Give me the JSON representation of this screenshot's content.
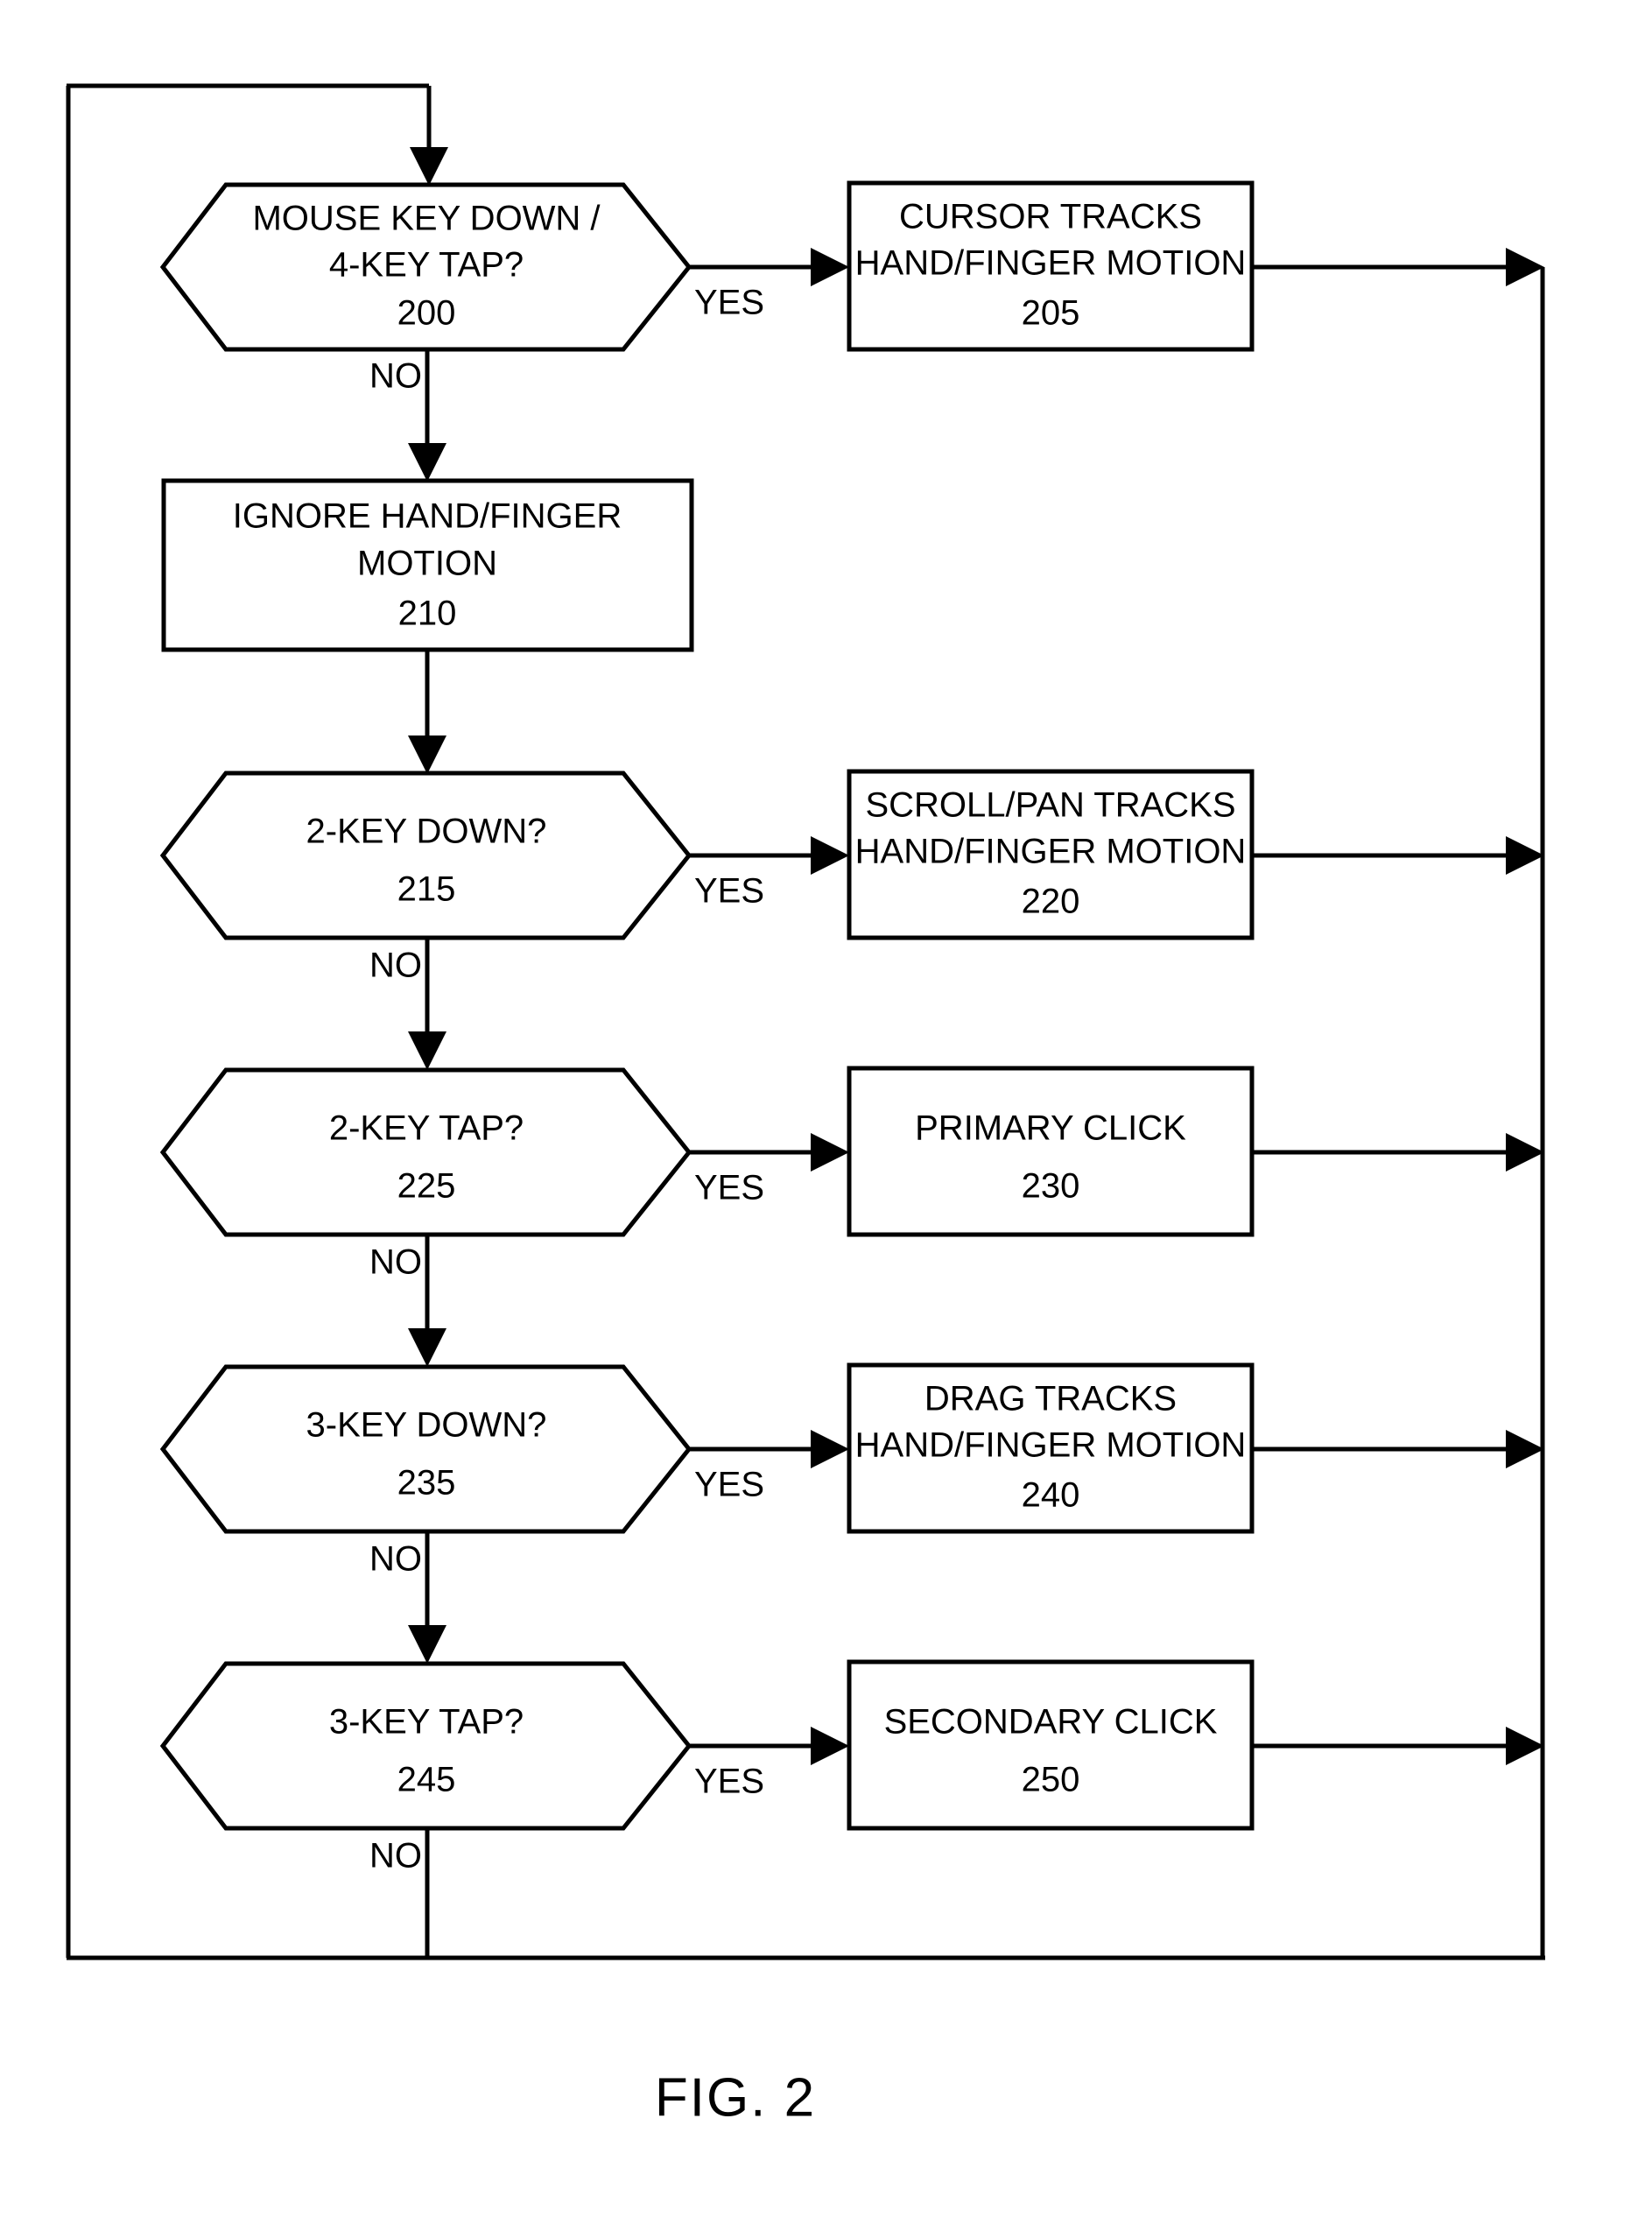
{
  "figure": {
    "caption": "FIG. 2",
    "type": "flowchart"
  },
  "edge_labels": {
    "yes": "YES",
    "no": "NO"
  },
  "nodes": [
    {
      "id": "200",
      "shape": "hexagon",
      "lines": [
        "MOUSE KEY DOWN /",
        "4-KEY TAP?"
      ],
      "ref": "200"
    },
    {
      "id": "205",
      "shape": "rectangle",
      "lines": [
        "CURSOR TRACKS",
        "HAND/FINGER MOTION"
      ],
      "ref": "205"
    },
    {
      "id": "210",
      "shape": "rectangle",
      "lines": [
        "IGNORE HAND/FINGER",
        "MOTION"
      ],
      "ref": "210"
    },
    {
      "id": "215",
      "shape": "hexagon",
      "lines": [
        "2-KEY DOWN?"
      ],
      "ref": "215"
    },
    {
      "id": "220",
      "shape": "rectangle",
      "lines": [
        "SCROLL/PAN TRACKS",
        "HAND/FINGER MOTION"
      ],
      "ref": "220"
    },
    {
      "id": "225",
      "shape": "hexagon",
      "lines": [
        "2-KEY TAP?"
      ],
      "ref": "225"
    },
    {
      "id": "230",
      "shape": "rectangle",
      "lines": [
        "PRIMARY CLICK"
      ],
      "ref": "230"
    },
    {
      "id": "235",
      "shape": "hexagon",
      "lines": [
        "3-KEY DOWN?"
      ],
      "ref": "235"
    },
    {
      "id": "240",
      "shape": "rectangle",
      "lines": [
        "DRAG TRACKS",
        "HAND/FINGER MOTION"
      ],
      "ref": "240"
    },
    {
      "id": "245",
      "shape": "hexagon",
      "lines": [
        "3-KEY TAP?"
      ],
      "ref": "245"
    },
    {
      "id": "250",
      "shape": "rectangle",
      "lines": [
        "SECONDARY CLICK"
      ],
      "ref": "250"
    }
  ],
  "text": {
    "n200_l1": "MOUSE KEY DOWN /",
    "n200_l2": "4-KEY TAP?",
    "n200_ref": "200",
    "n205_l1": "CURSOR TRACKS",
    "n205_l2": "HAND/FINGER MOTION",
    "n205_ref": "205",
    "n210_l1": "IGNORE HAND/FINGER",
    "n210_l2": "MOTION",
    "n210_ref": "210",
    "n215_l1": "2-KEY DOWN?",
    "n215_ref": "215",
    "n220_l1": "SCROLL/PAN TRACKS",
    "n220_l2": "HAND/FINGER MOTION",
    "n220_ref": "220",
    "n225_l1": "2-KEY TAP?",
    "n225_ref": "225",
    "n230_l1": "PRIMARY CLICK",
    "n230_ref": "230",
    "n235_l1": "3-KEY DOWN?",
    "n235_ref": "235",
    "n240_l1": "DRAG TRACKS",
    "n240_l2": "HAND/FINGER MOTION",
    "n240_ref": "240",
    "n245_l1": "3-KEY TAP?",
    "n245_ref": "245",
    "n250_l1": "SECONDARY CLICK",
    "n250_ref": "250",
    "yes_200": "YES",
    "yes_215": "YES",
    "yes_225": "YES",
    "yes_235": "YES",
    "yes_245": "YES",
    "no_200": "NO",
    "no_215": "NO",
    "no_225": "NO",
    "no_235": "NO",
    "no_245": "NO",
    "caption": "FIG. 2"
  },
  "colors": {
    "stroke": "#000000",
    "fill": "#ffffff",
    "background": "#ffffff"
  }
}
